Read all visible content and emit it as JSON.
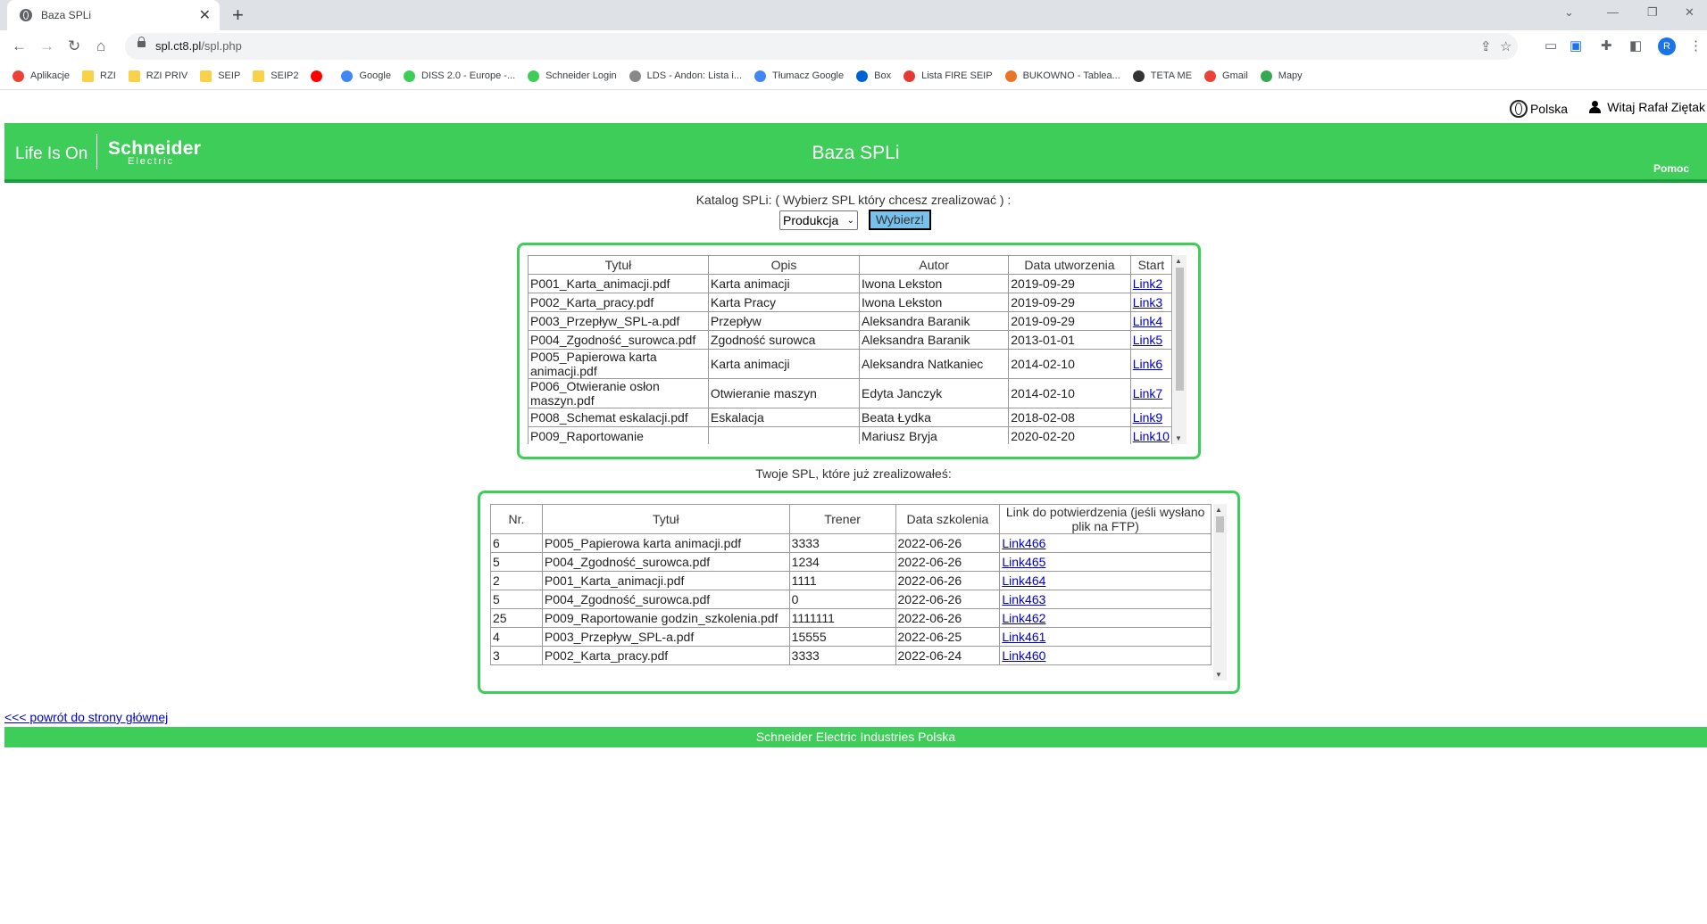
{
  "browser": {
    "tab_title": "Baza SPLi",
    "url_host": "spl.ct8.pl",
    "url_path": "/spl.php",
    "profile_initial": "R",
    "bookmarks": [
      {
        "label": "Aplikacje",
        "icon": "apps-grid-icon",
        "color": "#ea4335"
      },
      {
        "label": "RZI",
        "icon": "folder-icon",
        "color": "#f9d24a"
      },
      {
        "label": "RZI PRIV",
        "icon": "folder-icon",
        "color": "#f9d24a"
      },
      {
        "label": "SEIP",
        "icon": "folder-icon",
        "color": "#f9d24a"
      },
      {
        "label": "SEIP2",
        "icon": "folder-icon",
        "color": "#f9d24a"
      },
      {
        "label": "",
        "icon": "youtube-icon",
        "color": "#ff0000"
      },
      {
        "label": "Google",
        "icon": "google-icon",
        "color": "#4285f4"
      },
      {
        "label": "DISS 2.0 - Europe -...",
        "icon": "diss-icon",
        "color": "#3dcd58"
      },
      {
        "label": "Schneider Login",
        "icon": "schneider-icon",
        "color": "#3dcd58"
      },
      {
        "label": "LDS - Andon: Lista i...",
        "icon": "lds-icon",
        "color": "#888888"
      },
      {
        "label": "Tłumacz Google",
        "icon": "translate-icon",
        "color": "#4285f4"
      },
      {
        "label": "Box",
        "icon": "box-icon",
        "color": "#0061d5"
      },
      {
        "label": "Lista FIRE SEIP",
        "icon": "fire-icon",
        "color": "#e53935"
      },
      {
        "label": "BUKOWNO - Tablea...",
        "icon": "tableau-icon",
        "color": "#e97627"
      },
      {
        "label": "TETA ME",
        "icon": "teta-icon",
        "color": "#333333"
      },
      {
        "label": "Gmail",
        "icon": "gmail-icon",
        "color": "#ea4335"
      },
      {
        "label": "Mapy",
        "icon": "maps-icon",
        "color": "#34a853"
      }
    ]
  },
  "topbar": {
    "language": "Polska",
    "greeting": "Witaj Rafał Ziętak"
  },
  "header": {
    "slogan": "Life Is On",
    "brand": "Schneider",
    "brand_sub": "Electric",
    "title": "Baza SPLi",
    "help": "Pomoc"
  },
  "catalog": {
    "label": "Katalog SPLi: ( Wybierz SPL który chcesz zrealizować ) :",
    "select_value": "Produkcja",
    "button": "Wybierz!",
    "columns": [
      "Tytuł",
      "Opis",
      "Autor",
      "Data utworzenia",
      "Start"
    ],
    "rows": [
      [
        "P001_Karta_animacji.pdf",
        "Karta animacji",
        "Iwona Lekston",
        "2019-09-29",
        "Link2"
      ],
      [
        "P002_Karta_pracy.pdf",
        "Karta Pracy",
        "Iwona Lekston",
        "2019-09-29",
        "Link3"
      ],
      [
        "P003_Przepływ_SPL-a.pdf",
        "Przepływ",
        "Aleksandra Baranik",
        "2019-09-29",
        "Link4"
      ],
      [
        "P004_Zgodność_surowca.pdf",
        "Zgodność surowca",
        "Aleksandra Baranik",
        "2013-01-01",
        "Link5"
      ],
      [
        "P005_Papierowa karta animacji.pdf",
        "Karta animacji",
        "Aleksandra Natkaniec",
        "2014-02-10",
        "Link6"
      ],
      [
        "P006_Otwieranie osłon maszyn.pdf",
        "Otwieranie maszyn",
        "Edyta Janczyk",
        "2014-02-10",
        "Link7"
      ],
      [
        "P008_Schemat eskalacji.pdf",
        "Eskalacja",
        "Beata Łydka",
        "2018-02-08",
        "Link9"
      ],
      [
        "P009_Raportowanie",
        "",
        "Mariusz Bryja",
        "2020-02-20",
        "Link10"
      ]
    ]
  },
  "completed": {
    "label": "Twoje SPL, które już zrealizowałeś:",
    "columns": [
      "Nr.",
      "Tytuł",
      "Trener",
      "Data szkolenia",
      "Link do potwierdzenia (jeśli wysłano plik na FTP)"
    ],
    "rows": [
      [
        "6",
        "P005_Papierowa karta animacji.pdf",
        "3333",
        "2022-06-26",
        "Link466"
      ],
      [
        "5",
        "P004_Zgodność_surowca.pdf",
        "1234",
        "2022-06-26",
        "Link465"
      ],
      [
        "2",
        "P001_Karta_animacji.pdf",
        "1111",
        "2022-06-26",
        "Link464"
      ],
      [
        "5",
        "P004_Zgodność_surowca.pdf",
        "0",
        "2022-06-26",
        "Link463"
      ],
      [
        "25",
        "P009_Raportowanie godzin_szkolenia.pdf",
        "1111111",
        "2022-06-26",
        "Link462"
      ],
      [
        "4",
        "P003_Przepływ_SPL-a.pdf",
        "15555",
        "2022-06-25",
        "Link461"
      ],
      [
        "3",
        "P002_Karta_pracy.pdf",
        "3333",
        "2022-06-24",
        "Link460"
      ]
    ]
  },
  "back_link": "<<< powrót do strony głównej",
  "footer": "Schneider Electric Industries Polska",
  "colors": {
    "brand_green": "#3dcd58",
    "button_blue": "#76c2ec"
  }
}
